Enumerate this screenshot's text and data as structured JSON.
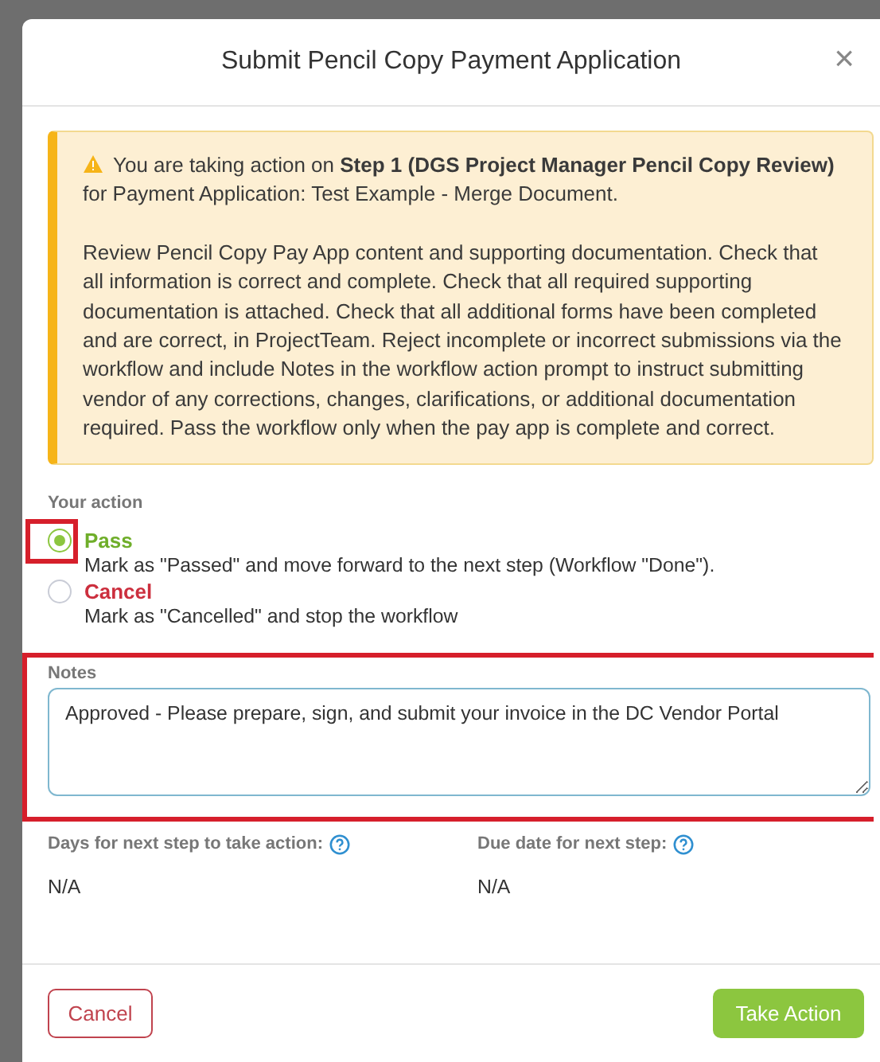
{
  "dialog": {
    "title": "Submit Pencil Copy Payment Application",
    "close": "×"
  },
  "alert": {
    "intro": "You are taking action on **Step 1 (DGS Project Manager Pencil Copy Review)** for Payment Application: Test Example - Merge Document.",
    "body": "Review Pencil Copy Pay App content and supporting documentation. Check that all information is correct and complete. Check that all required supporting documentation is attached. Check that all additional forms have been completed and are correct, in ProjectTeam. Reject incomplete or incorrect submissions via the workflow and include Notes in the workflow action prompt to instruct submitting vendor of any corrections, changes, clarifications, or additional documentation required. Pass the workflow only when the pay app is complete and correct."
  },
  "action": {
    "label": "Your action",
    "options": [
      {
        "kind": "pass",
        "label": "Pass",
        "description": "Mark as \"Passed\" and move forward to the next step (Workflow \"Done\").",
        "selected": true,
        "highlighted": true
      },
      {
        "kind": "cancel",
        "label": "Cancel",
        "description": "Mark as \"Cancelled\" and stop the workflow",
        "selected": false,
        "highlighted": false
      }
    ]
  },
  "notes": {
    "label": "Notes",
    "value": "Approved - Please prepare, sign, and submit your invoice in the DC Vendor Portal",
    "highlighted": true
  },
  "info": [
    {
      "label": "Days for next step to take action:",
      "value": "N/A"
    },
    {
      "label": "Due date for next step:",
      "value": "N/A"
    }
  ],
  "buttons": [
    {
      "kind": "secondary",
      "label": "Cancel"
    },
    {
      "kind": "primary",
      "label": "Take Action"
    }
  ]
}
